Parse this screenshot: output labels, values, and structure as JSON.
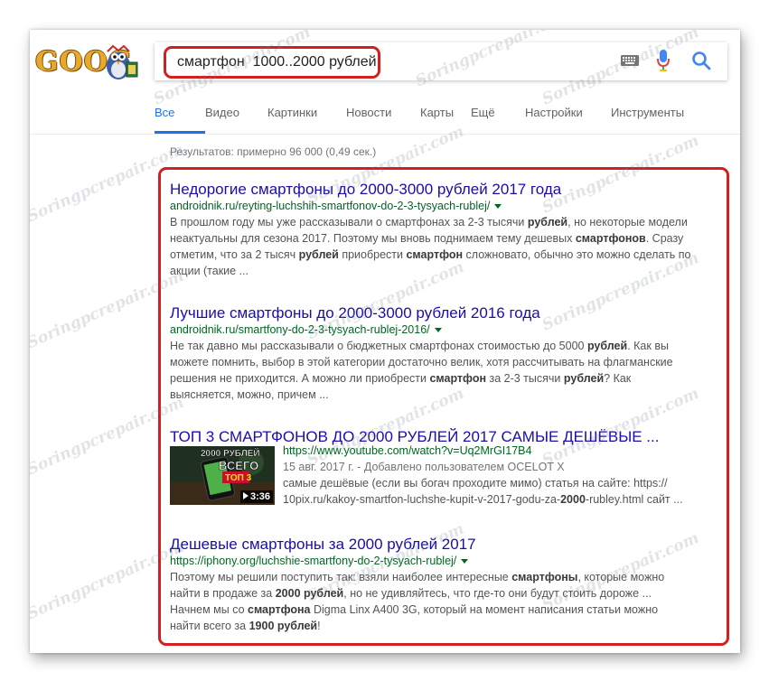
{
  "search": {
    "query": "смартфон  1000..2000 рублей"
  },
  "logo": {
    "text": "GOOG"
  },
  "tabs": [
    {
      "label": "Все"
    },
    {
      "label": "Видео"
    },
    {
      "label": "Картинки"
    },
    {
      "label": "Новости"
    },
    {
      "label": "Карты"
    },
    {
      "label": "Ещё"
    },
    {
      "label": "Настройки"
    },
    {
      "label": "Инструменты"
    }
  ],
  "stats": "Результатов: примерно 96 000 (0,49 сек.)",
  "results": [
    {
      "title": "Недорогие смартфоны до 2000-3000 рублей 2017 года",
      "url": "androidnik.ru/reyting-luchshih-smartfonov-do-2-3-tysyach-rublej/",
      "snippet": [
        [
          {
            "t": "В прошлом году мы уже рассказывали о смартфонах за 2-3 тысячи "
          },
          {
            "t": "рублей",
            "b": true
          },
          {
            "t": ", но некоторые модели"
          }
        ],
        [
          {
            "t": "неактуальны для сезона 2017. Поэтому мы вновь поднимаем тему дешевых "
          },
          {
            "t": "смартфонов",
            "b": true
          },
          {
            "t": ". Сразу"
          }
        ],
        [
          {
            "t": "отметим, что за 2 тысяч "
          },
          {
            "t": "рублей",
            "b": true
          },
          {
            "t": " приобрести "
          },
          {
            "t": "смартфон",
            "b": true
          },
          {
            "t": " сложновато, обычно это можно сделать по"
          }
        ],
        [
          {
            "t": "акции (такие ..."
          }
        ]
      ]
    },
    {
      "title": "Лучшие смартфоны до 2000-3000 рублей 2016 года",
      "url": "androidnik.ru/smartfony-do-2-3-tysyach-rublej-2016/",
      "snippet": [
        [
          {
            "t": "Не так давно мы рассказывали о бюджетных смартфонах стоимостью до 5000 "
          },
          {
            "t": "рублей",
            "b": true
          },
          {
            "t": ". Как вы"
          }
        ],
        [
          {
            "t": "можете помнить, выбор в этой категории достаточно велик, хотя рассчитывать на флагманские"
          }
        ],
        [
          {
            "t": "решения не приходится. А можно ли приобрести "
          },
          {
            "t": "смартфон",
            "b": true
          },
          {
            "t": " за 2-3 тысячи "
          },
          {
            "t": "рублей",
            "b": true
          },
          {
            "t": "? Как"
          }
        ],
        [
          {
            "t": "выясняется, можно, причем ..."
          }
        ]
      ]
    },
    {
      "title": "ТОП 3 СМАРТФОНОВ ДО 2000 РУБЛЕЙ 2017 САМЫЕ ДЕШЁВЫЕ ...",
      "url": "https://www.youtube.com/watch?v=Uq2MrGI17B4",
      "date_line": "15 авг. 2017 г. - Добавлено пользователем OCELOT X",
      "thumb_top": "2000 РУБЛЕЙ",
      "thumb_mid": "ВСЕГО",
      "thumb_badge": "ТОП 3",
      "duration": "3:36",
      "snippet": [
        [
          {
            "t": "самые дешёвые (если вы богач проходите мимо) статья на сайте: https://"
          }
        ],
        [
          {
            "t": "10pix.ru/kakoy-smartfon-luchshe-kupit-v-2017-godu-za-"
          },
          {
            "t": "2000",
            "b": true
          },
          {
            "t": "-rubley.html сайт ..."
          }
        ]
      ]
    },
    {
      "title": "Дешевые смартфоны за 2000 рублей 2017",
      "url": "https://iphony.org/luchshie-smartfony-do-2-tysyach-rublej/",
      "snippet": [
        [
          {
            "t": "Поэтому мы решили поступить так: взяли наиболее интересные "
          },
          {
            "t": "смартфоны",
            "b": true
          },
          {
            "t": ", которые можно"
          }
        ],
        [
          {
            "t": "найти в продаже за "
          },
          {
            "t": "2000 рублей",
            "b": true
          },
          {
            "t": ", но не удивляйтесь, что где-то они будут стоить дороже ..."
          }
        ],
        [
          {
            "t": "Начнем мы со "
          },
          {
            "t": "смартфона",
            "b": true
          },
          {
            "t": " Digma Linx A400 3G, который на момент написания статьи можно"
          }
        ],
        [
          {
            "t": "найти всего за "
          },
          {
            "t": "1900 рублей",
            "b": true
          },
          {
            "t": "!"
          }
        ]
      ]
    }
  ],
  "watermark": "Soringpcrepair.com",
  "colors": {
    "link": "#1a0dab",
    "url": "#006621",
    "accent": "#1a73e8",
    "highlight": "#d21f1f"
  }
}
